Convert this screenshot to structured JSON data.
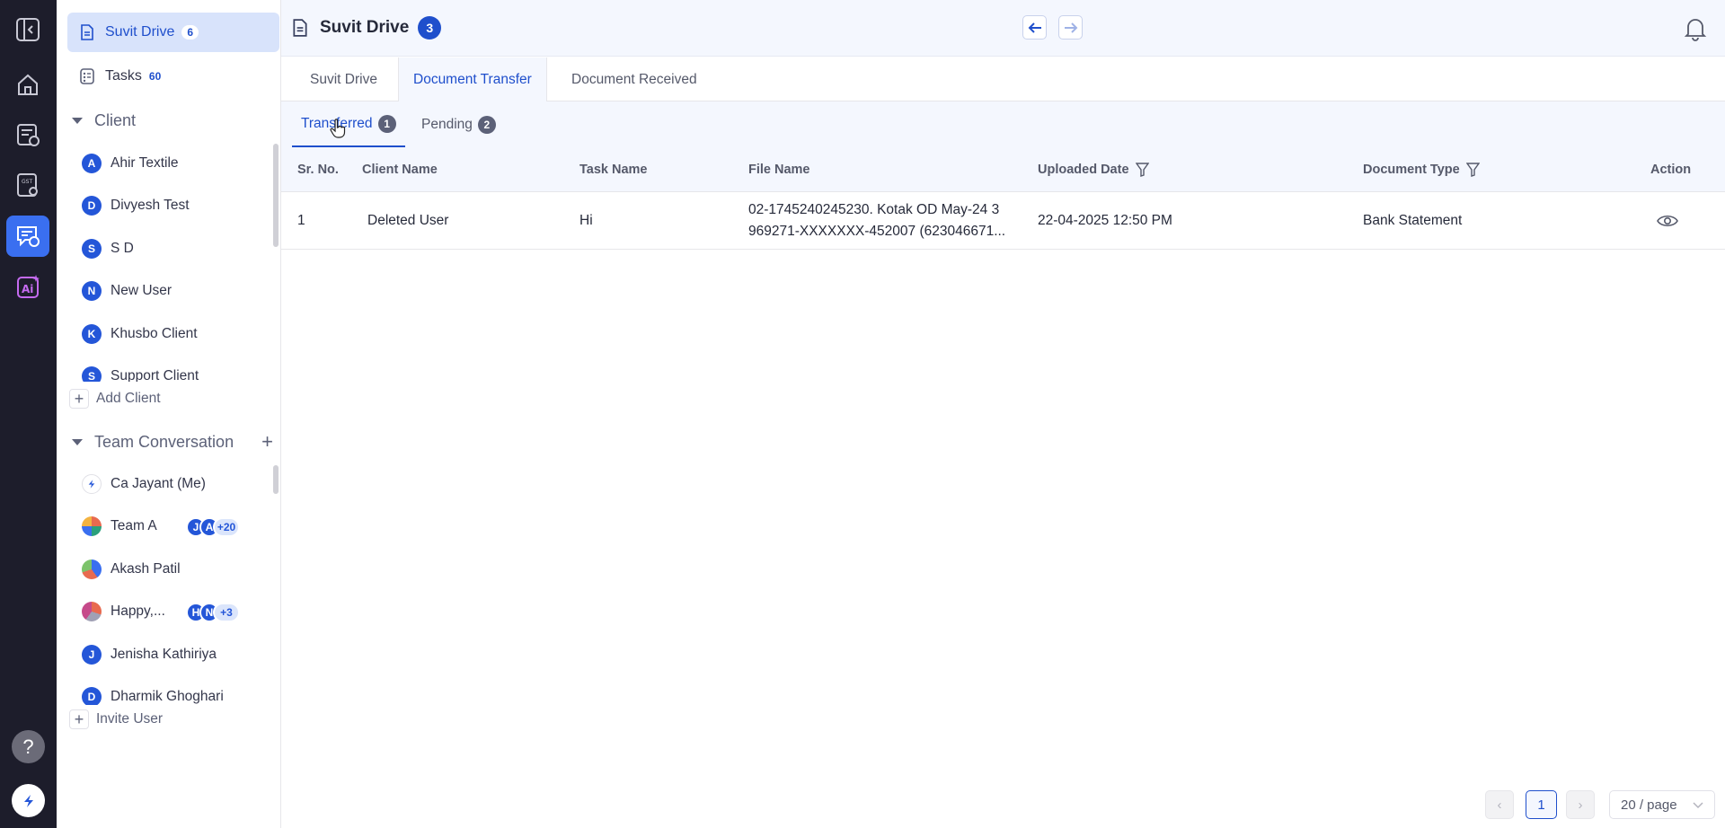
{
  "rail": {
    "items": [
      {
        "name": "collapse",
        "icon": "collapse-icon"
      },
      {
        "name": "home",
        "icon": "home-icon"
      },
      {
        "name": "tasks",
        "icon": "task-sync-icon"
      },
      {
        "name": "gst",
        "icon": "gst-icon"
      },
      {
        "name": "chat",
        "icon": "chat-clock-icon"
      },
      {
        "name": "ai",
        "icon": "ai-icon"
      }
    ],
    "help": "?"
  },
  "sidebar": {
    "drive": {
      "label": "Suvit Drive",
      "count": "6"
    },
    "tasks": {
      "label": "Tasks",
      "count": "60"
    },
    "client_section": "Client",
    "clients": [
      {
        "initial": "A",
        "name": "Ahir Textile"
      },
      {
        "initial": "D",
        "name": "Divyesh Test"
      },
      {
        "initial": "S",
        "name": "S D"
      },
      {
        "initial": "N",
        "name": "New User"
      },
      {
        "initial": "K",
        "name": "Khusbo Client"
      },
      {
        "initial": "S",
        "name": "Support Client"
      }
    ],
    "add_client": "Add Client",
    "team_section": "Team Conversation",
    "team": [
      {
        "initial": "",
        "name": "Ca Jayant (Me)"
      },
      {
        "initial": "",
        "name": "Team A",
        "stack": [
          "J",
          "A"
        ],
        "more": "+20"
      },
      {
        "initial": "",
        "name": "Akash Patil"
      },
      {
        "initial": "",
        "name": "Happy,...",
        "stack": [
          "H",
          "N"
        ],
        "more": "+3"
      },
      {
        "initial": "J",
        "name": "Jenisha Kathiriya"
      },
      {
        "initial": "D",
        "name": "Dharmik Ghoghari"
      }
    ],
    "invite_user": "Invite User"
  },
  "header": {
    "title": "Suvit Drive",
    "badge": "3"
  },
  "tabs": [
    {
      "label": "Suvit Drive"
    },
    {
      "label": "Document Transfer"
    },
    {
      "label": "Document Received"
    }
  ],
  "subtabs": [
    {
      "label": "Transferred",
      "count": "1"
    },
    {
      "label": "Pending",
      "count": "2"
    }
  ],
  "table": {
    "columns": [
      "Sr. No.",
      "Client Name",
      "Task Name",
      "File Name",
      "Uploaded Date",
      "Document Type",
      "Action"
    ],
    "rows": [
      {
        "sr": "1",
        "client": "Deleted User",
        "task": "Hi",
        "file_line1": "02-1745240245230. Kotak OD May-24 3",
        "file_line2": "969271-XXXXXXX-452007 (623046671...",
        "date": "22-04-2025 12:50 PM",
        "type": "Bank Statement"
      }
    ]
  },
  "pagination": {
    "page": "1",
    "size": "20 / page"
  }
}
